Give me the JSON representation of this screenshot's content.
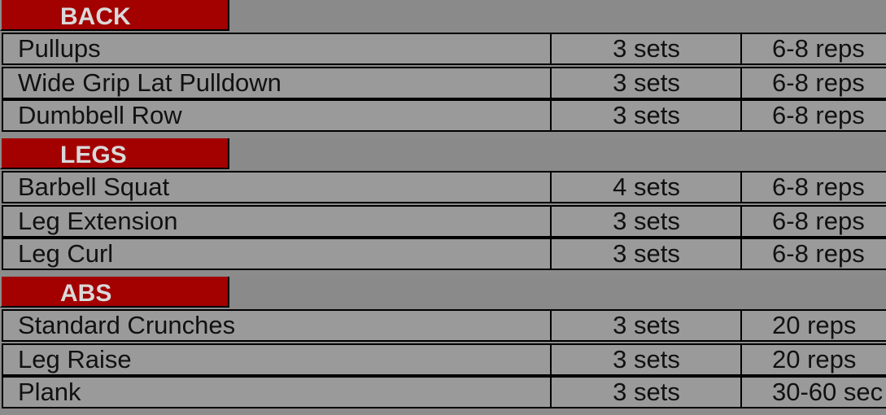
{
  "sections": [
    {
      "title": "BACK",
      "exercises": [
        {
          "name": "Pullups",
          "sets": "3 sets",
          "reps": "6-8 reps"
        },
        {
          "name": "Wide Grip Lat Pulldown",
          "sets": "3 sets",
          "reps": "6-8 reps"
        },
        {
          "name": "Dumbbell Row",
          "sets": "3 sets",
          "reps": "6-8 reps"
        }
      ]
    },
    {
      "title": "LEGS",
      "exercises": [
        {
          "name": "Barbell Squat",
          "sets": "4 sets",
          "reps": "6-8 reps"
        },
        {
          "name": "Leg Extension",
          "sets": "3 sets",
          "reps": "6-8 reps"
        },
        {
          "name": "Leg Curl",
          "sets": "3 sets",
          "reps": "6-8 reps"
        }
      ]
    },
    {
      "title": "ABS",
      "exercises": [
        {
          "name": "Standard Crunches",
          "sets": "3 sets",
          "reps": "20 reps"
        },
        {
          "name": "Leg Raise",
          "sets": "3 sets",
          "reps": "20 reps"
        },
        {
          "name": "Plank",
          "sets": "3 sets",
          "reps": "30-60 sec"
        }
      ]
    }
  ],
  "colors": {
    "background": "#8c8c8c",
    "cell": "#9a9a9a",
    "header_tab": "#a30000",
    "header_text": "#d9d9d9",
    "text": "#111111",
    "border": "#000000"
  }
}
